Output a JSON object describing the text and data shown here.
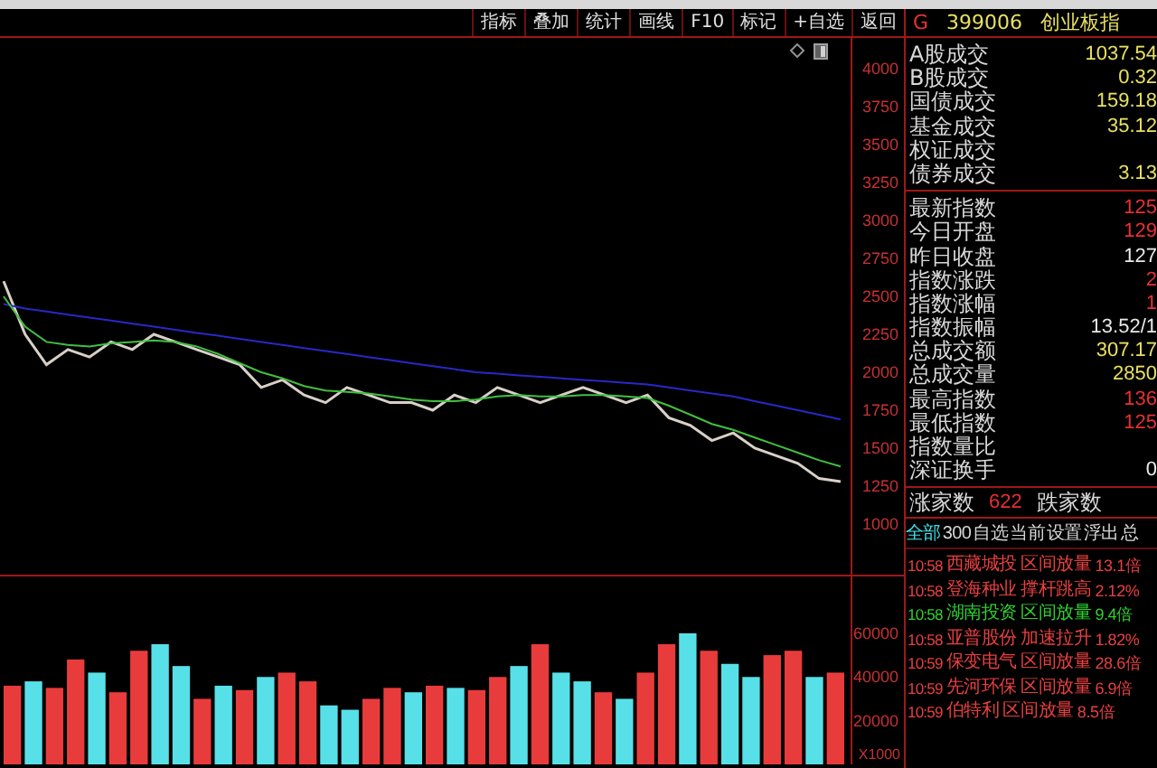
{
  "toolbar": {
    "buttons": [
      "指标",
      "叠加",
      "统计",
      "画线",
      "F10",
      "标记",
      "+自选",
      "返回"
    ]
  },
  "price_chart": {
    "chart_data": {
      "type": "line",
      "ylim": [
        667,
        4202
      ],
      "yticks": [
        1000,
        1250,
        1500,
        1750,
        2000,
        2250,
        2500,
        2750,
        3000,
        3250,
        3500,
        3750,
        4000
      ],
      "series": [
        {
          "color": "#d8d0c8",
          "values": [
            2600,
            2250,
            2050,
            2150,
            2100,
            2200,
            2150,
            2250,
            2200,
            2150,
            2100,
            2050,
            1900,
            1950,
            1850,
            1800,
            1900,
            1850,
            1800,
            1800,
            1750,
            1850,
            1800,
            1900,
            1850,
            1800,
            1850,
            1900,
            1850,
            1800,
            1850,
            1700,
            1650,
            1550,
            1600,
            1500,
            1450,
            1400,
            1300,
            1280
          ]
        },
        {
          "color": "#2828c8",
          "values": [
            2450,
            2420,
            2400,
            2380,
            2360,
            2340,
            2320,
            2300,
            2280,
            2260,
            2240,
            2220,
            2200,
            2180,
            2160,
            2140,
            2120,
            2100,
            2080,
            2060,
            2040,
            2020,
            2000,
            1990,
            1980,
            1970,
            1960,
            1950,
            1940,
            1930,
            1920,
            1900,
            1880,
            1860,
            1840,
            1810,
            1780,
            1750,
            1720,
            1690
          ]
        },
        {
          "color": "#40c040",
          "values": [
            2500,
            2300,
            2200,
            2180,
            2170,
            2190,
            2200,
            2210,
            2200,
            2170,
            2120,
            2060,
            2000,
            1960,
            1910,
            1880,
            1870,
            1860,
            1840,
            1820,
            1810,
            1810,
            1820,
            1840,
            1850,
            1840,
            1840,
            1850,
            1850,
            1840,
            1830,
            1780,
            1720,
            1660,
            1620,
            1570,
            1520,
            1470,
            1420,
            1380
          ]
        }
      ]
    }
  },
  "volume_chart": {
    "chart_data": {
      "type": "bar",
      "ylabel": "X1000",
      "ylim": [
        0,
        86000
      ],
      "yticks": [
        20000,
        40000,
        60000
      ],
      "series": [
        {
          "color": "#e83c3c",
          "values": [
            36000,
            null,
            35000,
            48000,
            null,
            33000,
            52000,
            null,
            null,
            30000,
            null,
            34000,
            null,
            42000,
            38000,
            null,
            null,
            30000,
            35000,
            null,
            36000,
            null,
            34000,
            40000,
            null,
            55000,
            null,
            null,
            33000,
            null,
            42000,
            55000,
            null,
            52000,
            null,
            null,
            50000,
            52000,
            null,
            42000
          ]
        },
        {
          "color": "#58e0e8",
          "values": [
            null,
            38000,
            null,
            null,
            42000,
            null,
            null,
            55000,
            45000,
            null,
            36000,
            null,
            40000,
            null,
            null,
            27000,
            25000,
            null,
            null,
            33000,
            null,
            35000,
            null,
            null,
            45000,
            null,
            42000,
            38000,
            null,
            30000,
            null,
            null,
            60000,
            null,
            46000,
            40000,
            null,
            null,
            40000,
            null
          ]
        }
      ]
    }
  },
  "quote_panel": {
    "flag": "G",
    "code": "399006",
    "name": "创业板指",
    "turnover": [
      {
        "label": "A股成交",
        "value": "1037.54",
        "color": "#e8e060"
      },
      {
        "label": "B股成交",
        "value": "0.32",
        "color": "#e8e060"
      },
      {
        "label": "国债成交",
        "value": "159.18",
        "color": "#e8e060"
      },
      {
        "label": "基金成交",
        "value": "35.12",
        "color": "#e8e060"
      },
      {
        "label": "权证成交"
      },
      {
        "label": "债券成交",
        "value": "3.13",
        "color": "#e8e060"
      }
    ],
    "index_stats": [
      {
        "label": "最新指数",
        "value": "125",
        "color": "#e83030"
      },
      {
        "label": "今日开盘",
        "value": "129",
        "color": "#e83030"
      },
      {
        "label": "昨日收盘",
        "value": "127",
        "color": "#e8e8e8"
      },
      {
        "label": "指数涨跌",
        "value": "2",
        "color": "#e83030"
      },
      {
        "label": "指数涨幅",
        "value": "1",
        "color": "#e83030"
      },
      {
        "label": "指数振幅",
        "value": "13.52/1",
        "color": "#e8e8e8"
      },
      {
        "label": "总成交额",
        "value": "307.17",
        "color": "#e8e060"
      },
      {
        "label": "总成交量",
        "value": "2850",
        "color": "#e8e060"
      },
      {
        "label": "最高指数",
        "value": "136",
        "color": "#e83030"
      },
      {
        "label": "最低指数",
        "value": "125",
        "color": "#e83030"
      },
      {
        "label": "指数量比"
      },
      {
        "label": "深证换手",
        "value": "0",
        "color": "#e8e8e8"
      }
    ],
    "breadth": {
      "up_label": "涨家数",
      "up_count": "622",
      "down_label": "跌家数"
    },
    "alert_tabs": [
      {
        "label": "全部",
        "selected": true
      },
      {
        "label": "300",
        "selected": false
      },
      {
        "label": "自选",
        "selected": false
      },
      {
        "label": "当前",
        "selected": false
      },
      {
        "label": "设置",
        "selected": false
      },
      {
        "label": "浮出",
        "selected": false
      },
      {
        "label": "总",
        "selected": false
      }
    ],
    "alerts": [
      {
        "time": "10:58",
        "stock": "西藏城投",
        "event": "区间放量",
        "value": "13.1倍",
        "color": "#e84040"
      },
      {
        "time": "10:58",
        "stock": "登海种业",
        "event": "撑杆跳高",
        "value": "2.12%",
        "color": "#e84040"
      },
      {
        "time": "10:58",
        "stock": "湖南投资",
        "event": "区间放量",
        "value": "9.4倍",
        "color": "#30d030"
      },
      {
        "time": "10:58",
        "stock": "亚普股份",
        "event": "加速拉升",
        "value": "1.82%",
        "color": "#e84040"
      },
      {
        "time": "10:59",
        "stock": "保变电气",
        "event": "区间放量",
        "value": "28.6倍",
        "color": "#e84040"
      },
      {
        "time": "10:59",
        "stock": "先河环保",
        "event": "区间放量",
        "value": "6.9倍",
        "color": "#e84040"
      },
      {
        "time": "10:59",
        "stock": "伯特利",
        "event": "区间放量",
        "value": "8.5倍",
        "color": "#e84040"
      }
    ]
  }
}
